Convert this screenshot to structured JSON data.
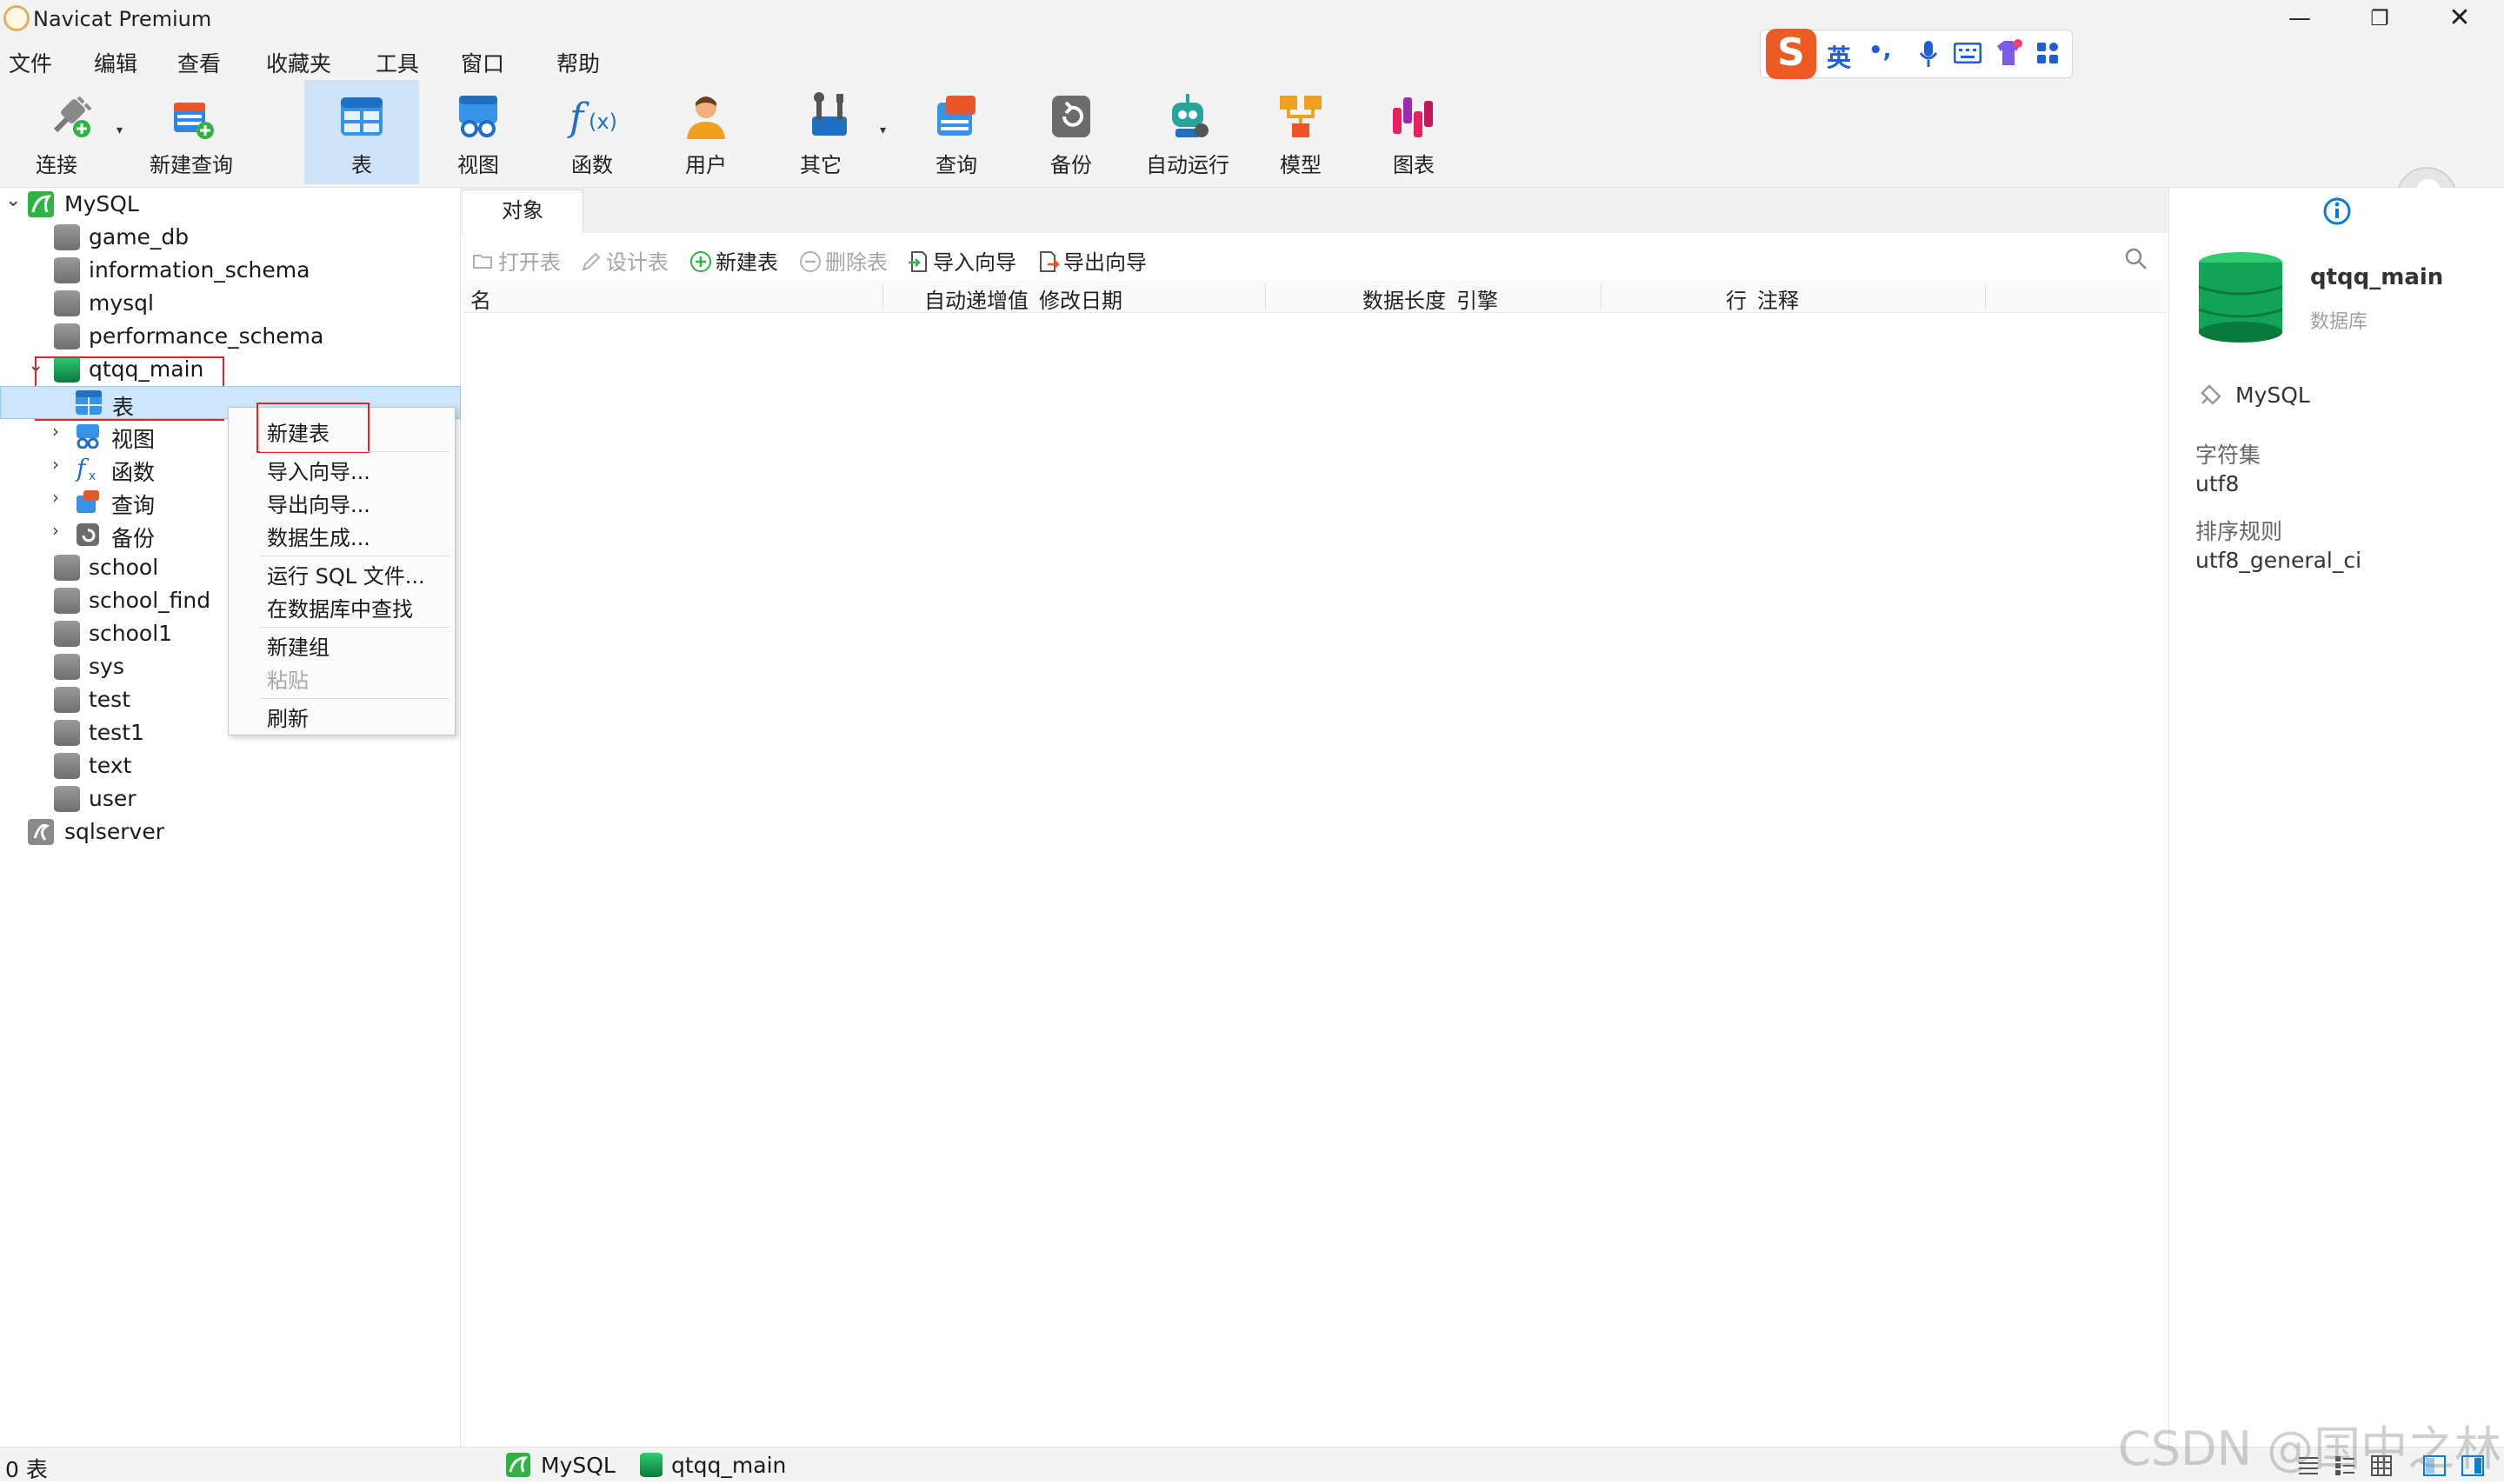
{
  "window": {
    "title": "Navicat Premium"
  },
  "menu": [
    "文件",
    "编辑",
    "查看",
    "收藏夹",
    "工具",
    "窗口",
    "帮助"
  ],
  "toolbar": {
    "connect": "连接",
    "new_query": "新建查询",
    "table": "表",
    "view": "视图",
    "function": "函数",
    "user": "用户",
    "other": "其它",
    "query": "查询",
    "backup": "备份",
    "automation": "自动运行",
    "model": "模型",
    "chart": "图表"
  },
  "ime": {
    "mode": "英",
    "punct": "•,"
  },
  "tree": {
    "root": "MySQL",
    "databases_top": [
      "game_db",
      "information_schema",
      "mysql",
      "performance_schema"
    ],
    "open_db": "qtqq_main",
    "children": [
      "表",
      "视图",
      "函数",
      "查询",
      "备份"
    ],
    "databases_bottom": [
      "school",
      "school_find",
      "school1",
      "sys",
      "test",
      "test1",
      "text",
      "user"
    ],
    "root2": "sqlserver"
  },
  "context_menu": {
    "items": [
      "新建表",
      "导入向导...",
      "导出向导...",
      "数据生成...",
      "运行 SQL 文件...",
      "在数据库中查找",
      "新建组",
      "粘贴",
      "刷新"
    ]
  },
  "main": {
    "tab": "对象",
    "tools": {
      "open": "打开表",
      "design": "设计表",
      "new": "新建表",
      "delete": "删除表",
      "import": "导入向导",
      "export": "导出向导"
    },
    "columns": [
      "名",
      "自动递增值",
      "修改日期",
      "数据长度",
      "引擎",
      "行",
      "注释"
    ]
  },
  "info": {
    "db_name": "qtqq_main",
    "db_type": "数据库",
    "connection": "MySQL",
    "charset_label": "字符集",
    "charset": "utf8",
    "collation_label": "排序规则",
    "collation": "utf8_general_ci"
  },
  "status": {
    "count": "0 表",
    "conn": "MySQL",
    "db": "qtqq_main"
  },
  "watermark": "CSDN @国中之林",
  "colors": {
    "accent": "#0a7cd6",
    "selection": "#cde6fb",
    "highlight_box": "#e0242b",
    "db_green": "#0a7a3c"
  }
}
